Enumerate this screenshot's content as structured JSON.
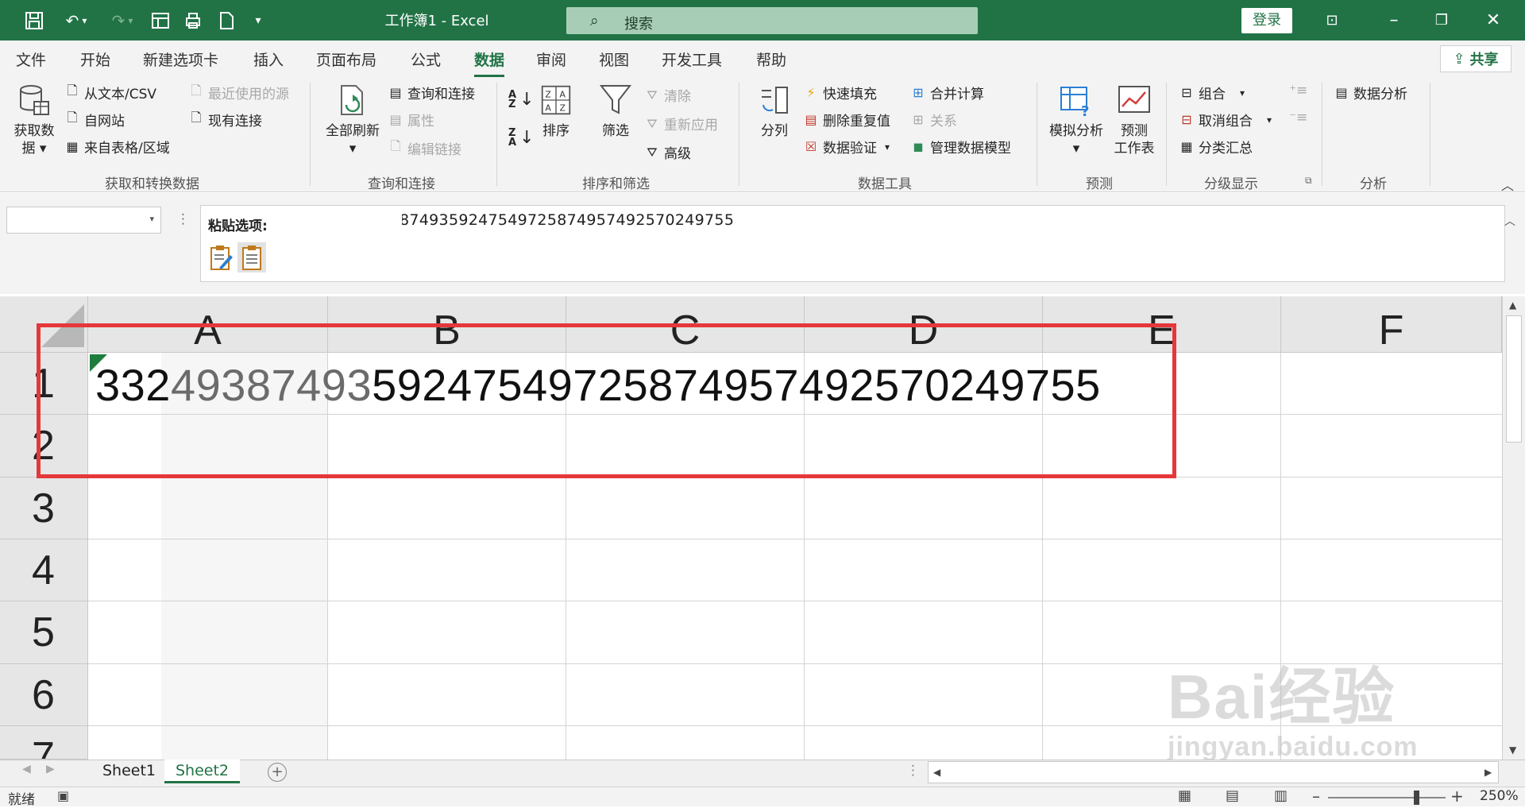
{
  "title_bar": {
    "document_title": "工作簿1  -  Excel",
    "search_placeholder": "搜索",
    "login_label": "登录",
    "accent_color": "#217346"
  },
  "ribbon_tabs": [
    {
      "label": "文件"
    },
    {
      "label": "开始"
    },
    {
      "label": "新建选项卡"
    },
    {
      "label": "插入"
    },
    {
      "label": "页面布局"
    },
    {
      "label": "公式"
    },
    {
      "label": "数据",
      "active": true
    },
    {
      "label": "审阅"
    },
    {
      "label": "视图"
    },
    {
      "label": "开发工具"
    },
    {
      "label": "帮助"
    }
  ],
  "share_label": "共享",
  "ribbon": {
    "get_transform": {
      "group_label": "获取和转换数据",
      "get_data_line1": "获取数",
      "get_data_line2": "据",
      "from_text_csv": "从文本/CSV",
      "from_web": "自网站",
      "from_table": "来自表格/区域",
      "recent_sources": "最近使用的源",
      "existing_connections": "现有连接"
    },
    "queries": {
      "group_label": "查询和连接",
      "refresh_all": "全部刷新",
      "queries_connections": "查询和连接",
      "properties": "属性",
      "edit_links": "编辑链接"
    },
    "sort_filter": {
      "group_label": "排序和筛选",
      "sort": "排序",
      "filter": "筛选",
      "clear": "清除",
      "reapply": "重新应用",
      "advanced": "高级"
    },
    "data_tools": {
      "group_label": "数据工具",
      "text_to_columns": "分列",
      "flash_fill": "快速填充",
      "remove_duplicates": "删除重复值",
      "data_validation": "数据验证",
      "consolidate": "合并计算",
      "relationships": "关系",
      "manage_data_model": "管理数据模型"
    },
    "forecast": {
      "group_label": "预测",
      "what_if": "模拟分析",
      "forecast_sheet_line1": "预测",
      "forecast_sheet_line2": "工作表"
    },
    "outline": {
      "group_label": "分级显示",
      "group": "组合",
      "ungroup": "取消组合",
      "subtotal": "分类汇总"
    },
    "analysis": {
      "group_label": "分析",
      "data_analysis": "数据分析"
    }
  },
  "formula_bar": {
    "name_box": "",
    "visible_formula_text": "8749359247549725874957492570249755",
    "paste_options_title": "粘贴选项:"
  },
  "grid": {
    "columns": [
      "A",
      "B",
      "C",
      "D",
      "E",
      "F"
    ],
    "rows": [
      "1",
      "2",
      "3",
      "4",
      "5",
      "6",
      "7"
    ],
    "cell_a1_part1": "332",
    "cell_a1_part2": "49387493",
    "cell_a1_part3": "59247549725874957492570249755"
  },
  "sheets": [
    {
      "label": "Sheet1",
      "active": false
    },
    {
      "label": "Sheet2",
      "active": true
    }
  ],
  "status": {
    "ready": "就绪",
    "zoom": "250%"
  },
  "watermark": {
    "brand": "Bai经验",
    "url": "jingyan.baidu.com"
  }
}
